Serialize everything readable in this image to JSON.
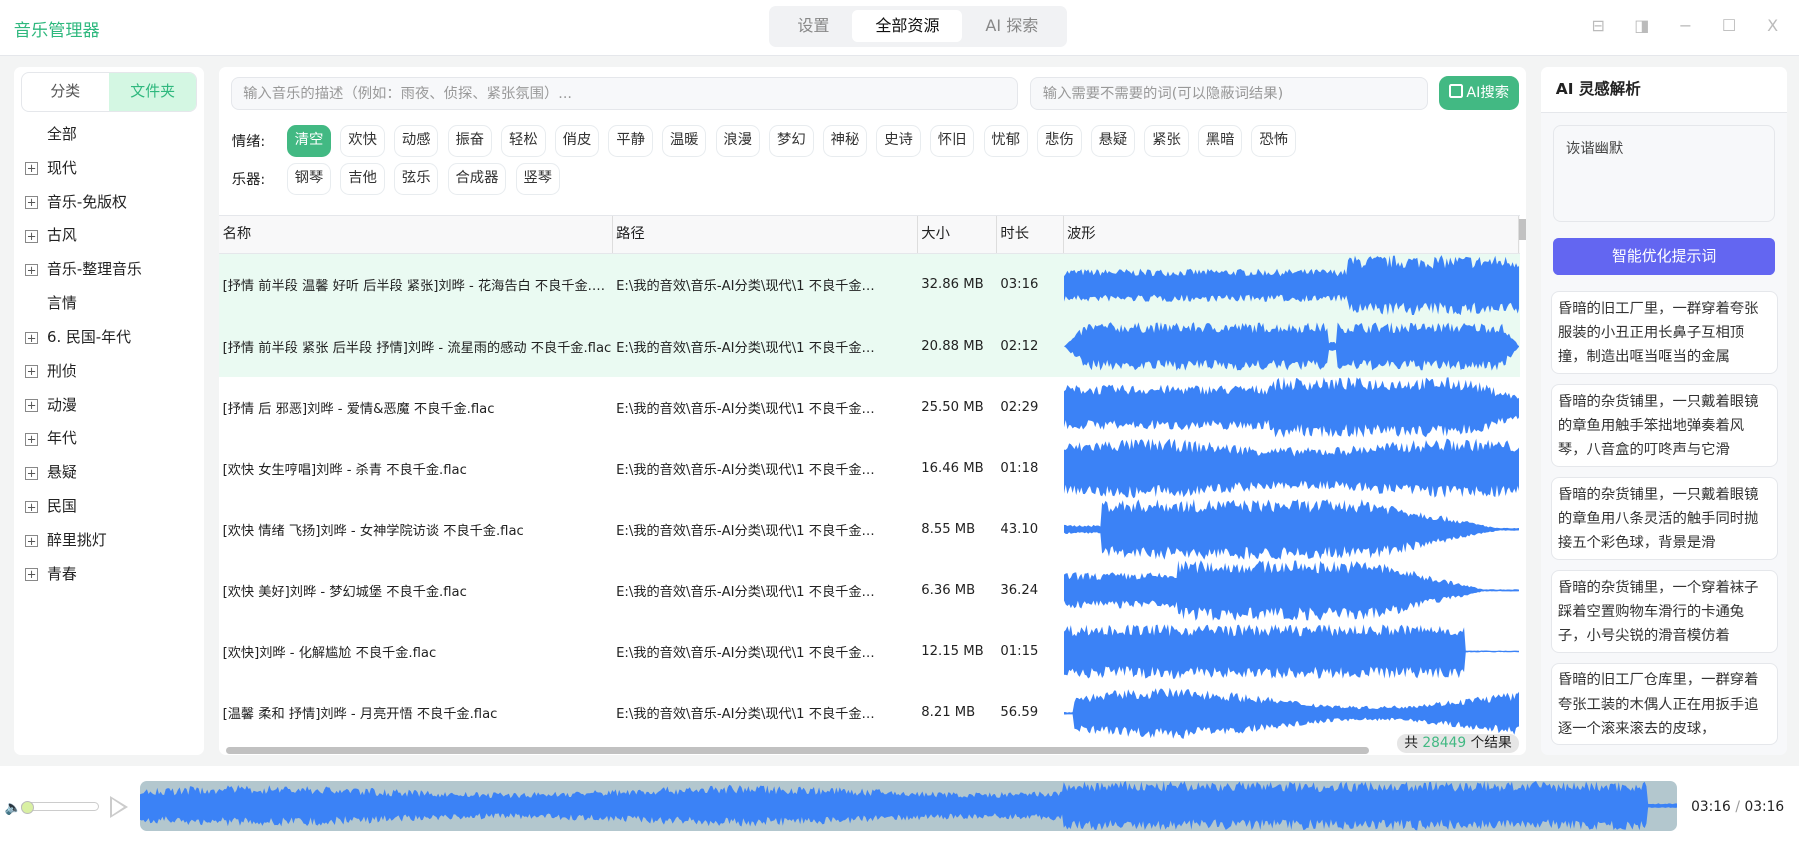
{
  "app": {
    "title": "音乐管理器"
  },
  "nav": {
    "tabs": [
      "设置",
      "全部资源",
      "AI 探索"
    ],
    "active": 1
  },
  "window_controls": [
    "⊟",
    "◨",
    "−",
    "☐",
    "X"
  ],
  "left": {
    "tabs": [
      "分类",
      "文件夹"
    ],
    "active": 1,
    "tree": [
      {
        "label": "全部",
        "exp": false
      },
      {
        "label": "现代",
        "exp": true
      },
      {
        "label": "音乐-免版权",
        "exp": true
      },
      {
        "label": "古风",
        "exp": true
      },
      {
        "label": "音乐-整理音乐",
        "exp": true
      },
      {
        "label": "言情",
        "exp": false
      },
      {
        "label": "6. 民国-年代",
        "exp": true
      },
      {
        "label": "刑侦",
        "exp": true
      },
      {
        "label": "动漫",
        "exp": true
      },
      {
        "label": "年代",
        "exp": true
      },
      {
        "label": "悬疑",
        "exp": true
      },
      {
        "label": "民国",
        "exp": true
      },
      {
        "label": "醉里挑灯",
        "exp": true
      },
      {
        "label": "青春",
        "exp": true
      }
    ]
  },
  "search": {
    "desc_placeholder": "输入音乐的描述（例如：雨夜、侦探、紧张氛围）...",
    "exclude_placeholder": "输入需要不需要的词(可以隐蔽词结果)",
    "ai_button": "AI搜索"
  },
  "mood": {
    "label": "情绪:",
    "tags": [
      "清空",
      "欢快",
      "动感",
      "振奋",
      "轻松",
      "俏皮",
      "平静",
      "温暖",
      "浪漫",
      "梦幻",
      "神秘",
      "史诗",
      "怀旧",
      "忧郁",
      "悲伤",
      "悬疑",
      "紧张",
      "黑暗",
      "恐怖"
    ]
  },
  "instrument": {
    "label": "乐器:",
    "tags": [
      "钢琴",
      "吉他",
      "弦乐",
      "合成器",
      "竖琴"
    ]
  },
  "table": {
    "columns": [
      "名称",
      "路径",
      "大小",
      "时长",
      "波形"
    ],
    "rows": [
      {
        "name": "[抒情 前半段 温馨 好听 后半段 紧张]刘晔 - 花海告白 不良千金.flac",
        "path": "E:\\我的音效\\音乐-AI分类\\现代\\1 不良千金…",
        "size": "32.86 MB",
        "duration": "03:16",
        "selected": true
      },
      {
        "name": "[抒情 前半段 紧张 后半段 抒情]刘晔 - 流星雨的感动 不良千金.flac",
        "path": "E:\\我的音效\\音乐-AI分类\\现代\\1 不良千金…",
        "size": "20.88 MB",
        "duration": "02:12",
        "selected": true
      },
      {
        "name": "[抒情 后 邪恶]刘晔 - 爱情&恶魔 不良千金.flac",
        "path": "E:\\我的音效\\音乐-AI分类\\现代\\1 不良千金…",
        "size": "25.50 MB",
        "duration": "02:29",
        "selected": false
      },
      {
        "name": "[欢快 女生哼唱]刘晔 - 杀青 不良千金.flac",
        "path": "E:\\我的音效\\音乐-AI分类\\现代\\1 不良千金…",
        "size": "16.46 MB",
        "duration": "01:18",
        "selected": false
      },
      {
        "name": "[欢快 情绪 飞扬]刘晔 - 女神学院访谈 不良千金.flac",
        "path": "E:\\我的音效\\音乐-AI分类\\现代\\1 不良千金…",
        "size": "8.55 MB",
        "duration": "43.10",
        "selected": false
      },
      {
        "name": "[欢快 美好]刘晔 - 梦幻城堡 不良千金.flac",
        "path": "E:\\我的音效\\音乐-AI分类\\现代\\1 不良千金…",
        "size": "6.36 MB",
        "duration": "36.24",
        "selected": false
      },
      {
        "name": "[欢快]刘晔 - 化解尴尬 不良千金.flac",
        "path": "E:\\我的音效\\音乐-AI分类\\现代\\1 不良千金…",
        "size": "12.15 MB",
        "duration": "01:15",
        "selected": false
      },
      {
        "name": "[温馨 柔和 抒情]刘晔 - 月亮开悟 不良千金.flac",
        "path": "E:\\我的音效\\音乐-AI分类\\现代\\1 不良千金…",
        "size": "8.21 MB",
        "duration": "56.59",
        "selected": false
      }
    ]
  },
  "results": {
    "prefix": "共",
    "count": "28449",
    "suffix": "个结果"
  },
  "ai_panel": {
    "title": "AI 灵感解析",
    "prompt": "诙谐幽默",
    "optimize_button": "智能优化提示词",
    "suggestions": [
      "昏暗的旧工厂里，一群穿着夸张服装的小丑正用长鼻子互相顶撞，制造出哐当哐当的金属",
      "昏暗的杂货铺里，一只戴着眼镜的章鱼用触手笨拙地弹奏着风琴，八音盒的叮咚声与它滑",
      "昏暗的杂货铺里，一只戴着眼镜的章鱼用八条灵活的触手同时抛接五个彩色球，背景是滑",
      "昏暗的杂货铺里，一个穿着袜子踩着空置购物车滑行的卡通兔子，小号尖锐的滑音模仿着",
      "昏暗的旧工厂仓库里，一群穿着夸张工装的木偶人正在用扳手追逐一个滚来滚去的皮球，"
    ]
  },
  "player": {
    "current": "03:16",
    "separator": "/",
    "total": "03:16",
    "volume": 0.05
  },
  "colors": {
    "accent": "#42b983",
    "wave": "#3b82f6",
    "ai": "#6366f1"
  }
}
